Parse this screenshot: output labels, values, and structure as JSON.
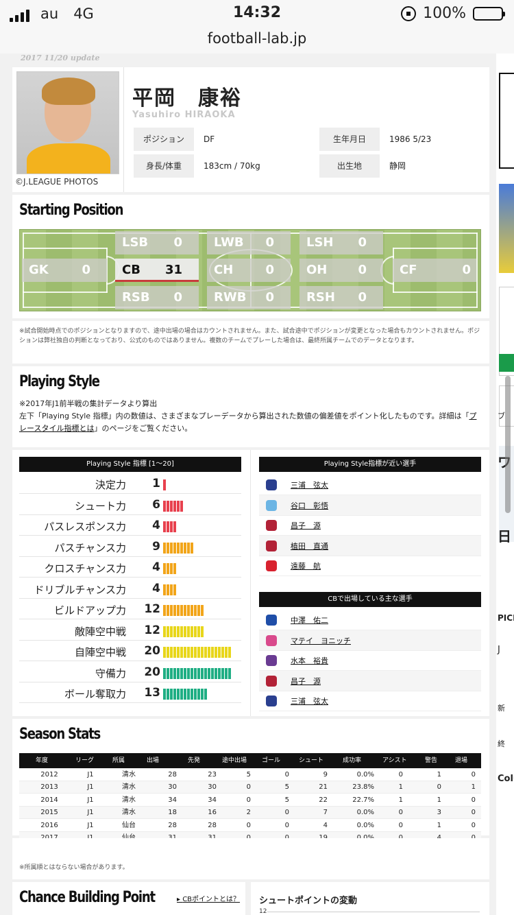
{
  "status": {
    "carrier": "au",
    "network": "4G",
    "time": "14:32",
    "battery": "100%"
  },
  "url": "football-lab.jp",
  "update_label": "2017 11/20 update",
  "player": {
    "name_jp": "平岡　康裕",
    "name_en": "Yasuhiro HIRAOKA",
    "photo_credit": "©J.LEAGUE PHOTOS",
    "fields": [
      {
        "label": "ポジション",
        "value": "DF"
      },
      {
        "label": "生年月日",
        "value": "1986 5/23"
      },
      {
        "label": "身長/体重",
        "value": "183cm / 70kg"
      },
      {
        "label": "出生地",
        "value": "静岡"
      }
    ]
  },
  "starting_position": {
    "title": "Starting Position",
    "positions": {
      "gk": {
        "label": "GK",
        "value": "0"
      },
      "lsb": {
        "label": "LSB",
        "value": "0"
      },
      "cb": {
        "label": "CB",
        "value": "31"
      },
      "rsb": {
        "label": "RSB",
        "value": "0"
      },
      "lwb": {
        "label": "LWB",
        "value": "0"
      },
      "ch": {
        "label": "CH",
        "value": "0"
      },
      "rwb": {
        "label": "RWB",
        "value": "0"
      },
      "lsh": {
        "label": "LSH",
        "value": "0"
      },
      "oh": {
        "label": "OH",
        "value": "0"
      },
      "rsh": {
        "label": "RSH",
        "value": "0"
      },
      "cf": {
        "label": "CF",
        "value": "0"
      }
    },
    "note": "※試合開始時点でのポジションとなりますので、途中出場の場合はカウントされません。また、試合途中でポジションが変更となった場合もカウントされません。ポジションは弊社独自の判断となっており、公式のものではありません。複数のチームでプレーした場合は、最終所属チームでのデータとなります。"
  },
  "playing_style": {
    "title": "Playing Style",
    "desc_line1": "※2017年J1前半戦の集計データより算出",
    "desc_line2": "左下「Playing Style 指標」内の数値は、さまざまなプレーデータから算出された数値の偏差値をポイント化したものです。詳細は「",
    "desc_link": "プレースタイル指標とは",
    "desc_line3": "」のページをご覧ください。",
    "index_header": "Playing Style 指標 [1〜20]",
    "metrics": [
      {
        "label": "決定力",
        "value": 1,
        "color": "#e8414e"
      },
      {
        "label": "シュート力",
        "value": 6,
        "color": "#e8414e"
      },
      {
        "label": "パスレスポンス力",
        "value": 4,
        "color": "#e8414e"
      },
      {
        "label": "パスチャンス力",
        "value": 9,
        "color": "#f2a51a"
      },
      {
        "label": "クロスチャンス力",
        "value": 4,
        "color": "#f2a51a"
      },
      {
        "label": "ドリブルチャンス力",
        "value": 4,
        "color": "#f2a51a"
      },
      {
        "label": "ビルドアップ力",
        "value": 12,
        "color": "#f2a51a"
      },
      {
        "label": "敵陣空中戦",
        "value": 12,
        "color": "#e8d61a"
      },
      {
        "label": "自陣空中戦",
        "value": 20,
        "color": "#e8d61a"
      },
      {
        "label": "守備力",
        "value": 20,
        "color": "#1fae84"
      },
      {
        "label": "ボール奪取力",
        "value": 13,
        "color": "#1fae84"
      }
    ],
    "similar_header": "Playing Style指標が近い選手",
    "similar": [
      {
        "name": "三浦　弦太",
        "color": "#2a3f8f"
      },
      {
        "name": "谷口　彰悟",
        "color": "#6cb5e4"
      },
      {
        "name": "昌子　源",
        "color": "#b22237"
      },
      {
        "name": "植田　直通",
        "color": "#b22237"
      },
      {
        "name": "遠藤　航",
        "color": "#d8222f"
      }
    ],
    "cb_header": "CBで出場している主な選手",
    "cb_players": [
      {
        "name": "中澤　佑二",
        "color": "#1f4ea8"
      },
      {
        "name": "マテイ　ヨニッチ",
        "color": "#d94a8c"
      },
      {
        "name": "水本　裕貴",
        "color": "#6a3b92"
      },
      {
        "name": "昌子　源",
        "color": "#b22237"
      },
      {
        "name": "三浦　弦太",
        "color": "#2a3f8f"
      }
    ]
  },
  "season_stats": {
    "title": "Season Stats",
    "headers": [
      "年度",
      "リーグ",
      "所属",
      "出場",
      "先発",
      "途中出場",
      "ゴール",
      "シュート",
      "成功率",
      "アシスト",
      "警告",
      "退場"
    ],
    "rows": [
      [
        "2012",
        "J1",
        "清水",
        "28",
        "23",
        "5",
        "0",
        "9",
        "0.0%",
        "0",
        "1",
        "0"
      ],
      [
        "2013",
        "J1",
        "清水",
        "30",
        "30",
        "0",
        "5",
        "21",
        "23.8%",
        "1",
        "0",
        "1"
      ],
      [
        "2014",
        "J1",
        "清水",
        "34",
        "34",
        "0",
        "5",
        "22",
        "22.7%",
        "1",
        "1",
        "0"
      ],
      [
        "2015",
        "J1",
        "清水",
        "18",
        "16",
        "2",
        "0",
        "7",
        "0.0%",
        "0",
        "3",
        "0"
      ],
      [
        "2016",
        "J1",
        "仙台",
        "28",
        "28",
        "0",
        "0",
        "4",
        "0.0%",
        "0",
        "1",
        "0"
      ],
      [
        "2017",
        "J1",
        "仙台",
        "31",
        "31",
        "0",
        "0",
        "19",
        "0.0%",
        "0",
        "4",
        "0"
      ]
    ],
    "note": "※所属順とはならない場合があります。"
  },
  "chance_building": {
    "title": "Chance Building Point",
    "link": "CBポイントとは？",
    "shoot_title": "シュートポイントの変動",
    "axis_top": "12"
  },
  "side": {
    "w1": "ワ",
    "w2": "日",
    "pick": "PICK",
    "colu": "Colu",
    "new": "新",
    "end": "終",
    "j": "J",
    "c": "ブ"
  }
}
